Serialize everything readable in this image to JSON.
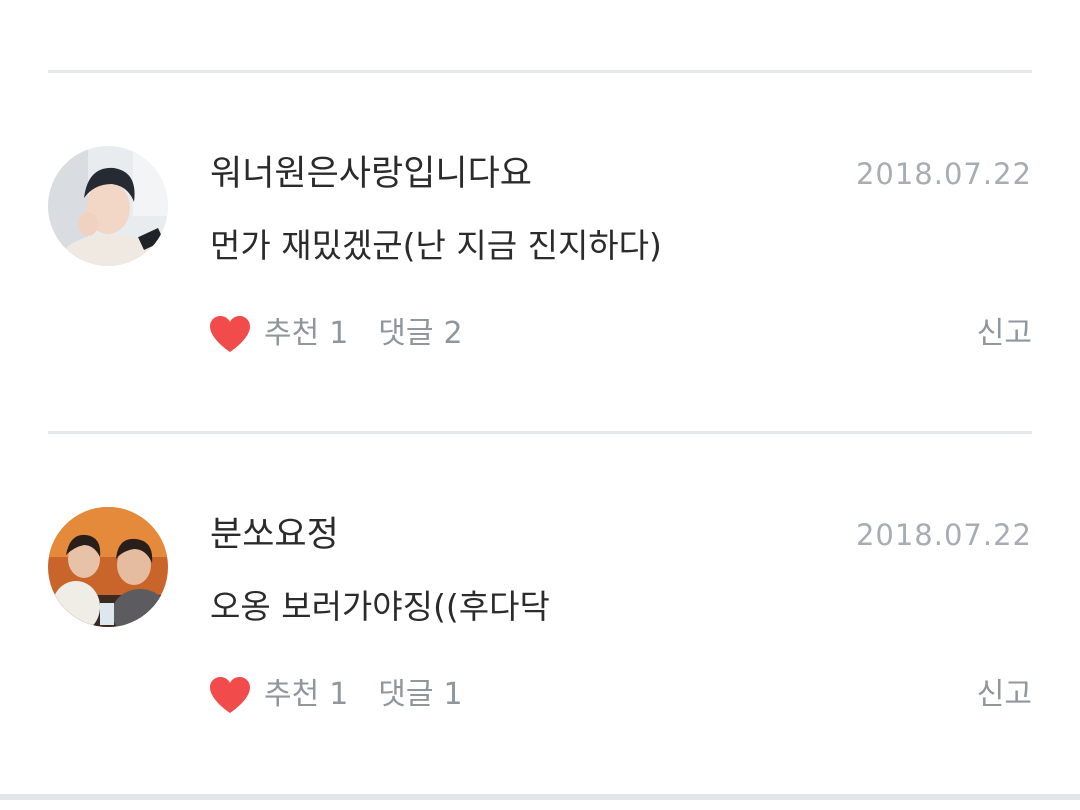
{
  "comments": [
    {
      "username": "워너원은사랑입니다요",
      "date": "2018.07.22",
      "text": "먼가 재밌겠군(난 지금 진지하다)",
      "like_label": "추천",
      "like_count": "1",
      "reply_label": "댓글",
      "reply_count": "2",
      "report_label": "신고"
    },
    {
      "username": "분쏘요정",
      "date": "2018.07.22",
      "text": "오옹 보러가야징((후다닥",
      "like_label": "추천",
      "like_count": "1",
      "reply_label": "댓글",
      "reply_count": "1",
      "report_label": "신고"
    }
  ],
  "colors": {
    "heart": "#f24b4b",
    "divider": "#e6e9ec",
    "muted_text": "#8f969c",
    "date_text": "#a7adb3"
  },
  "icons": {
    "like": "heart-icon",
    "avatar": "avatar"
  }
}
